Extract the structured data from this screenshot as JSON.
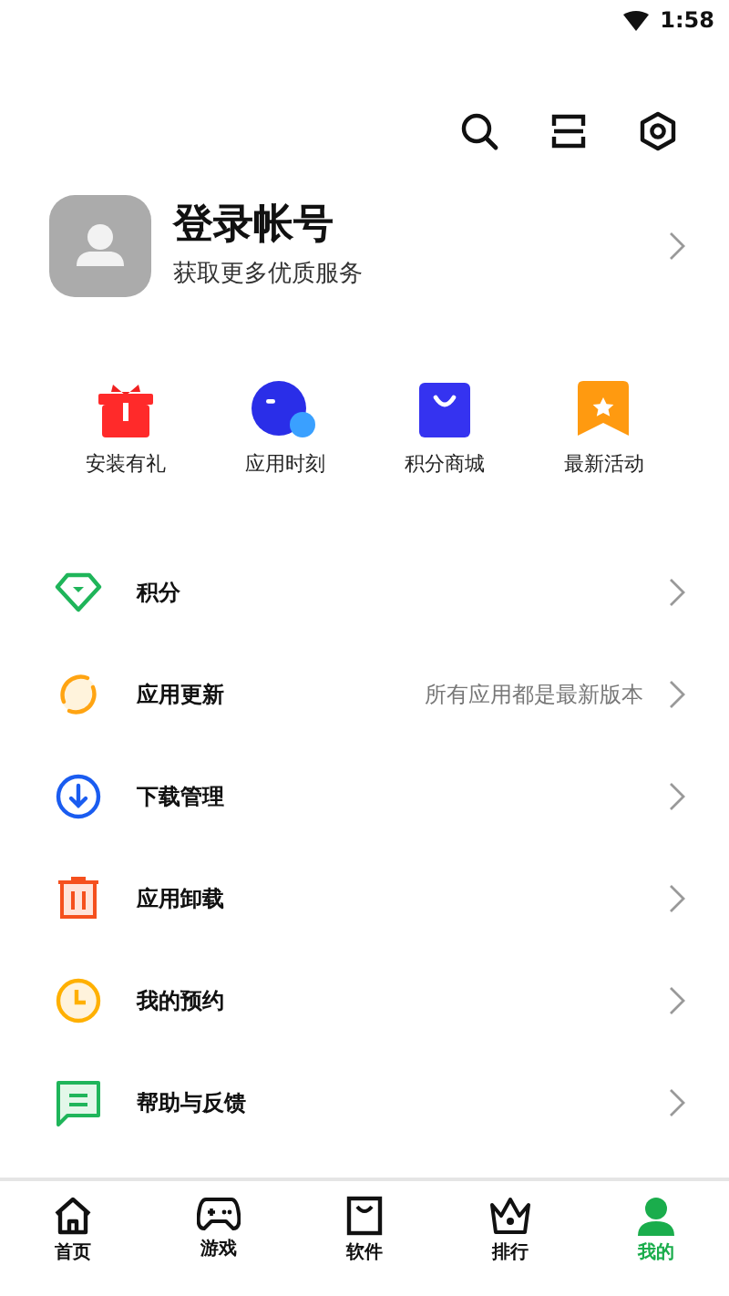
{
  "status_bar": {
    "time": "1:58"
  },
  "toolbar": [
    {
      "kind": "search"
    },
    {
      "kind": "scan"
    },
    {
      "kind": "settings"
    }
  ],
  "profile": {
    "title": "登录帐号",
    "subtitle": "获取更多优质服务"
  },
  "shortcuts": [
    {
      "kind": "gift",
      "label": "安装有礼"
    },
    {
      "kind": "bubble",
      "label": "应用时刻"
    },
    {
      "kind": "bag",
      "label": "积分商城"
    },
    {
      "kind": "ribbon",
      "label": "最新活动"
    }
  ],
  "menu": [
    {
      "kind": "gem",
      "label": "积分"
    },
    {
      "kind": "refresh",
      "label": "应用更新",
      "detail": "所有应用都是最新版本"
    },
    {
      "kind": "download",
      "label": "下载管理"
    },
    {
      "kind": "trash",
      "label": "应用卸载"
    },
    {
      "kind": "clock",
      "label": "我的预约"
    },
    {
      "kind": "chat",
      "label": "帮助与反馈"
    }
  ],
  "nav": [
    {
      "kind": "home",
      "label": "首页",
      "selected": false
    },
    {
      "kind": "game",
      "label": "游戏",
      "selected": false
    },
    {
      "kind": "box",
      "label": "软件",
      "selected": false
    },
    {
      "kind": "crown",
      "label": "排行",
      "selected": false
    },
    {
      "kind": "person",
      "label": "我的",
      "selected": true
    }
  ]
}
